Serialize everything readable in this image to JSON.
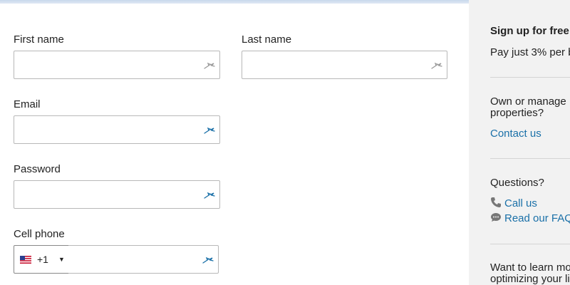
{
  "form": {
    "first_name_label": "First name",
    "last_name_label": "Last name",
    "email_label": "Email",
    "password_label": "Password",
    "cell_phone_label": "Cell phone",
    "phone_country_code": "+1",
    "phone_country_flag": "us-flag-icon"
  },
  "sidebar": {
    "signup_title": "Sign up for free",
    "signup_text": "Pay just 3% per b",
    "own_manage_line1": "Own or manage",
    "own_manage_line2": "properties?",
    "contact_link": "Contact us",
    "questions_label": "Questions?",
    "call_link": "Call us",
    "faq_link": "Read our FAQ",
    "learn_line1": "Want to learn mo",
    "learn_line2": "optimizing your li"
  },
  "colors": {
    "link": "#1a70a8",
    "sidebar_bg": "#f2f2f2",
    "border": "#b8b8b8"
  }
}
